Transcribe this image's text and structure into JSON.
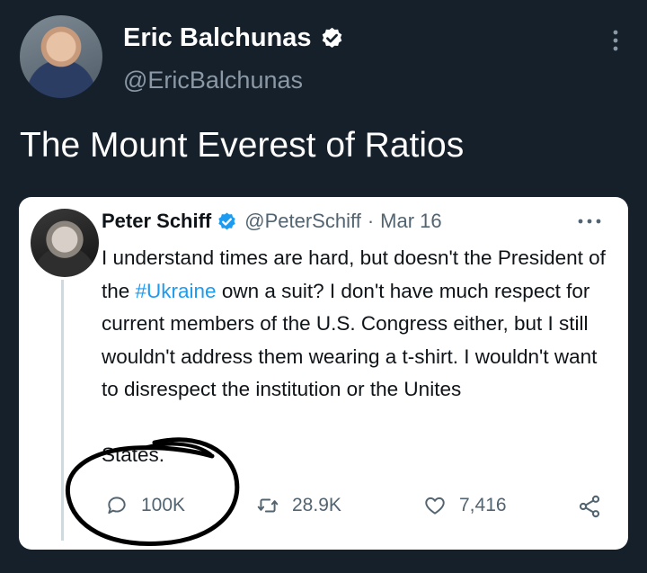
{
  "author": {
    "name": "Eric Balchunas",
    "handle": "@EricBalchunas"
  },
  "tweet_text": "The Mount Everest of Ratios",
  "quoted": {
    "name": "Peter Schiff",
    "handle": "@PeterSchiff",
    "separator": "·",
    "date": "Mar 16",
    "text_part1": "I understand times are hard, but doesn't the President of the ",
    "hashtag": "#Ukraine",
    "text_part2": " own a suit? I don't have much respect for current members of the U.S. Congress either, but I still wouldn't address them wearing a t-shirt. I wouldn't want to disrespect the institution or the Unites",
    "text_cut": "States.",
    "stats": {
      "replies": "100K",
      "retweets": "28.9K",
      "likes": "7,416"
    }
  },
  "icons": {
    "verified": "verified-badge-icon",
    "more": "more-vertical-icon",
    "reply": "reply-icon",
    "retweet": "retweet-icon",
    "like": "heart-icon",
    "share": "share-icon"
  },
  "colors": {
    "background": "#15202b",
    "card": "#ffffff",
    "link": "#1d9bf0",
    "verified": "#1d9bf0",
    "muted": "#536471",
    "annotation_ink": "#000000"
  }
}
